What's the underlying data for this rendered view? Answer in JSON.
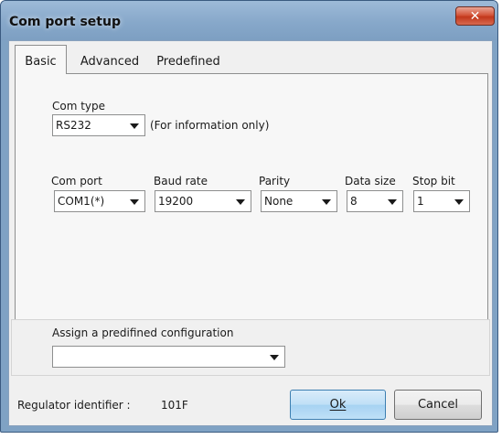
{
  "window": {
    "title": "Com port setup",
    "close_label": "✕"
  },
  "tabs": [
    {
      "label": "Basic"
    },
    {
      "label": "Advanced"
    },
    {
      "label": "Predefined"
    }
  ],
  "com_type": {
    "label": "Com type",
    "value": "RS232",
    "note": "(For information only)"
  },
  "port_settings": [
    {
      "label": "Com port",
      "value": "COM1(*)"
    },
    {
      "label": "Baud rate",
      "value": "19200"
    },
    {
      "label": "Parity",
      "value": "None"
    },
    {
      "label": "Data size",
      "value": "8"
    },
    {
      "label": "Stop bit",
      "value": "1"
    }
  ],
  "predefined": {
    "label": "Assign a predifined configuration",
    "value": ""
  },
  "footer": {
    "identifier_label": "Regulator identifier :",
    "identifier_value": "101F",
    "ok_label": "Ok",
    "cancel_label": "Cancel"
  }
}
